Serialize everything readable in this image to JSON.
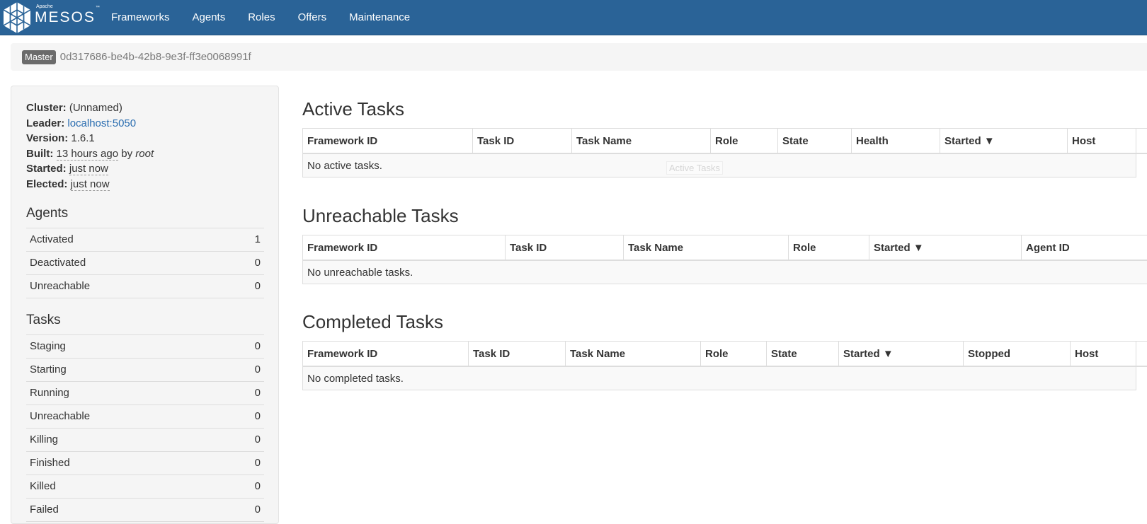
{
  "brand": {
    "apache": "Apache",
    "name": "MESOS",
    "tm": "™"
  },
  "nav": [
    "Frameworks",
    "Agents",
    "Roles",
    "Offers",
    "Maintenance"
  ],
  "breadcrumb": {
    "label": "Master",
    "id": "0d317686-be4b-42b8-9e3f-ff3e0068991f"
  },
  "cluster_info": {
    "cluster": {
      "key": "Cluster:",
      "value": "(Unnamed)"
    },
    "leader": {
      "key": "Leader:",
      "value": "localhost:5050"
    },
    "version": {
      "key": "Version:",
      "value": "1.6.1"
    },
    "built": {
      "key": "Built:",
      "value": "13 hours ago",
      "by": "by",
      "user": "root"
    },
    "started": {
      "key": "Started:",
      "value": "just now"
    },
    "elected": {
      "key": "Elected:",
      "value": "just now"
    }
  },
  "agents": {
    "heading": "Agents",
    "rows": [
      {
        "label": "Activated",
        "value": "1"
      },
      {
        "label": "Deactivated",
        "value": "0"
      },
      {
        "label": "Unreachable",
        "value": "0"
      }
    ]
  },
  "tasks": {
    "heading": "Tasks",
    "rows": [
      {
        "label": "Staging",
        "value": "0"
      },
      {
        "label": "Starting",
        "value": "0"
      },
      {
        "label": "Running",
        "value": "0"
      },
      {
        "label": "Unreachable",
        "value": "0"
      },
      {
        "label": "Killing",
        "value": "0"
      },
      {
        "label": "Finished",
        "value": "0"
      },
      {
        "label": "Killed",
        "value": "0"
      },
      {
        "label": "Failed",
        "value": "0"
      }
    ]
  },
  "active_tasks": {
    "title": "Active Tasks",
    "columns": [
      "Framework ID",
      "Task ID",
      "Task Name",
      "Role",
      "State",
      "Health",
      "Started ▼",
      "Host",
      ""
    ],
    "empty": "No active tasks.",
    "tooltip": "Active Tasks"
  },
  "unreachable_tasks": {
    "title": "Unreachable Tasks",
    "columns": [
      "Framework ID",
      "Task ID",
      "Task Name",
      "Role",
      "Started ▼",
      "Agent ID"
    ],
    "empty": "No unreachable tasks."
  },
  "completed_tasks": {
    "title": "Completed Tasks",
    "columns": [
      "Framework ID",
      "Task ID",
      "Task Name",
      "Role",
      "State",
      "Started ▼",
      "Stopped",
      "Host",
      ""
    ],
    "empty": "No completed tasks."
  }
}
